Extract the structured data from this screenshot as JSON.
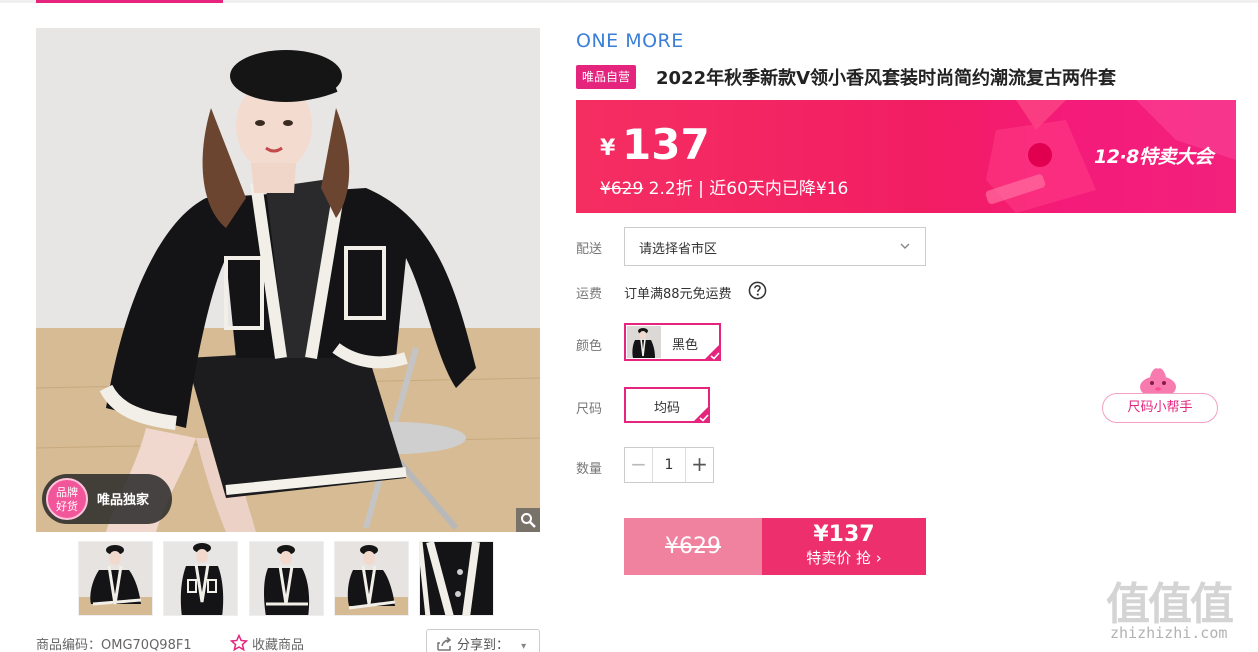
{
  "product": {
    "brand": "ONE MORE",
    "self_operated_badge": "唯品自营",
    "title": "2022年秋季新款V领小香风套装时尚简约潮流复古两件套",
    "exclusive_badge": {
      "circle_line1": "品牌",
      "circle_line2": "好货",
      "text": "唯品独家"
    },
    "thumbnail_count": 5
  },
  "price": {
    "currency_symbol": "¥",
    "current": "137",
    "original": "¥629",
    "discount": "2.2折",
    "separator": "|",
    "drop_note": "近60天内已降¥16",
    "promo": "12·8特卖大会"
  },
  "options": {
    "delivery_label": "配送",
    "delivery_placeholder": "请选择省市区",
    "shipping_label": "运费",
    "shipping_text": "订单满88元免运费",
    "color_label": "颜色",
    "color_value": "黑色",
    "size_label": "尺码",
    "size_value": "均码",
    "quantity_label": "数量",
    "quantity_minus": "−",
    "quantity_value": "1",
    "quantity_plus": "+"
  },
  "buy": {
    "original": "¥629",
    "price": "¥137",
    "cta": "特卖价 抢 ›"
  },
  "size_helper": "尺码小帮手",
  "meta": {
    "sku": "商品编码：OMG70Q98F1",
    "favorite": "收藏商品",
    "share": "分享到：",
    "share_arrow": "▾"
  },
  "watermark": {
    "logo": "值值值",
    "site": "zhizhizhi.com"
  },
  "colors": {
    "accent": "#e4247d",
    "brand_blue": "#3b7fd6",
    "banner": "#f21d64",
    "buy": "#ee2f6e",
    "buy_muted": "#f0829f"
  }
}
